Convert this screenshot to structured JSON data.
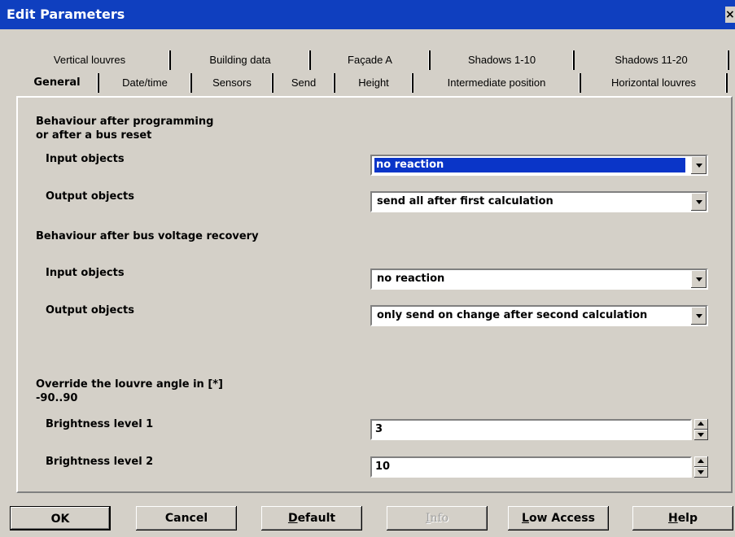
{
  "window": {
    "title": "Edit Parameters",
    "close_glyph": "×"
  },
  "tabs_row1": [
    "Vertical louvres",
    "Building data",
    "Façade A",
    "Shadows 1-10",
    "Shadows 11-20"
  ],
  "tabs_row2": [
    "General",
    "Date/time",
    "Sensors",
    "Send",
    "Height",
    "Intermediate position",
    "Horizontal louvres"
  ],
  "active_tab": "General",
  "sections": {
    "programming_heading_1": "Behaviour after programming",
    "programming_heading_2": "or after a bus reset",
    "voltage_heading": "Behaviour after bus voltage recovery",
    "override_heading_1": "Override the louvre angle in [*]",
    "override_heading_2": "-90..90"
  },
  "fields": {
    "prog_input_label": "Input objects",
    "prog_input_value": "no reaction",
    "prog_output_label": "Output objects",
    "prog_output_value": "send all after first calculation",
    "volt_input_label": "Input objects",
    "volt_input_value": "no reaction",
    "volt_output_label": "Output objects",
    "volt_output_value": "only send on change after second calculation",
    "bright1_label": "Brightness level 1",
    "bright1_value": "3",
    "bright2_label": "Brightness level 2",
    "bright2_value": "10"
  },
  "buttons": {
    "ok": "OK",
    "cancel": "Cancel",
    "default_pre": "",
    "default_u": "D",
    "default_post": "efault",
    "info_u": "I",
    "info_post": "nfo",
    "low_access_u": "L",
    "low_access_post": "ow Access",
    "help_u": "H",
    "help_post": "elp"
  },
  "colors": {
    "title_bar": "#0f3fbf",
    "selection": "#0a35c8",
    "face": "#d4d0c8"
  }
}
